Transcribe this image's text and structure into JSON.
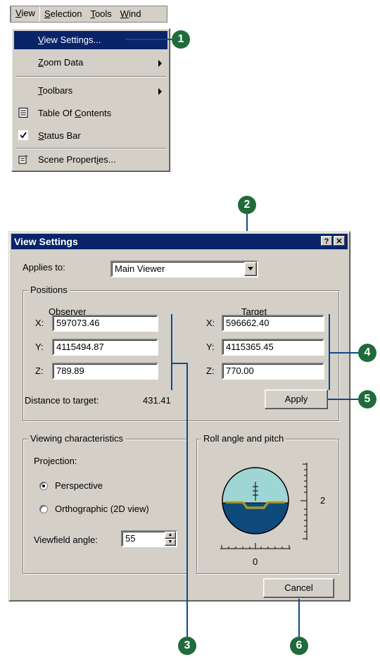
{
  "menubar": {
    "items": [
      {
        "label": "View",
        "ul": "V",
        "rest": "iew"
      },
      {
        "label": "Selection",
        "ul": "S",
        "rest": "election"
      },
      {
        "label": "Tools",
        "ul": "T",
        "rest": "ools"
      },
      {
        "label": "Windo",
        "ul": "W",
        "rest": "ind"
      }
    ]
  },
  "menu": {
    "view_settings": {
      "ul": "V",
      "rest": "iew Settings..."
    },
    "zoom_data": {
      "ul": "Z",
      "rest": "oom Data"
    },
    "toolbars": {
      "ul": "T",
      "rest": "oolbars"
    },
    "table_of_contents": {
      "pre": "Table Of ",
      "ul": "C",
      "rest": "ontents"
    },
    "status_bar": {
      "ul": "S",
      "rest": "tatus Bar"
    },
    "scene_properties": {
      "pre": "Scene Propert",
      "ul": "i",
      "rest": "es..."
    }
  },
  "callouts": {
    "c1": "1",
    "c2": "2",
    "c3": "3",
    "c4": "4",
    "c5": "5",
    "c6": "6"
  },
  "dialog": {
    "title": "View Settings",
    "help_btn": "?",
    "close_btn": "✕",
    "applies_to_label": "Applies to:",
    "applies_to_value": "Main Viewer",
    "positions_label": "Positions",
    "observer_label": "Observer",
    "target_label": "Target",
    "x_label": "X:",
    "y_label": "Y:",
    "z_label": "Z:",
    "observer": {
      "x": "597073.46",
      "y": "4115494.87",
      "z": "789.89"
    },
    "target": {
      "x": "596662.40",
      "y": "4115365.45",
      "z": "770.00"
    },
    "distance_label": "Distance to target:",
    "distance_value": "431.41",
    "apply": "Apply",
    "viewing_label": "Viewing characteristics",
    "projection_label": "Projection:",
    "perspective": "Perspective",
    "orthographic": "Orthographic (2D view)",
    "viewfield_label": "Viewfield angle:",
    "viewfield_value": "55",
    "roll_label": "Roll angle and pitch",
    "pitch_value": "2",
    "roll_value": "0",
    "cancel": "Cancel"
  },
  "colors": {
    "callout": "#1f6b3a",
    "line": "#0d4a8f",
    "title": "#0a246a",
    "sky": "#9ed5d5",
    "ground": "#0f4a7d",
    "horizon": "#e8c420"
  }
}
